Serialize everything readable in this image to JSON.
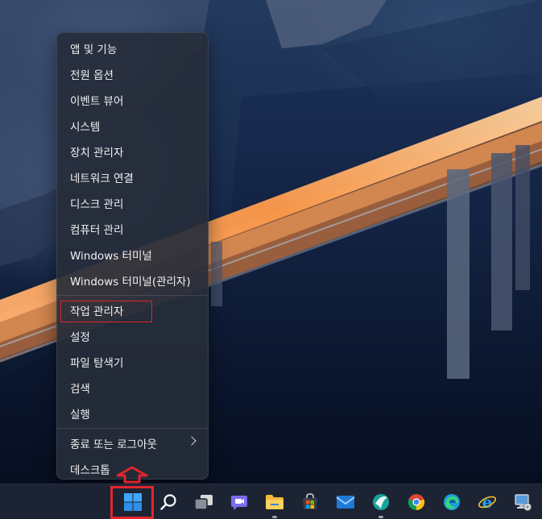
{
  "context_menu": {
    "items": [
      {
        "label": "앱 및 기능"
      },
      {
        "label": "전원 옵션"
      },
      {
        "label": "이벤트 뷰어"
      },
      {
        "label": "시스템"
      },
      {
        "label": "장치 관리자"
      },
      {
        "label": "네트워크 연결"
      },
      {
        "label": "디스크 관리"
      },
      {
        "label": "컴퓨터 관리"
      },
      {
        "label": "Windows 터미널"
      },
      {
        "label": "Windows 터미널(관리자)"
      },
      {
        "label": "작업 관리자"
      },
      {
        "label": "설정"
      },
      {
        "label": "파일 탐색기"
      },
      {
        "label": "검색"
      },
      {
        "label": "실행"
      },
      {
        "label": "종료 또는 로그아웃"
      },
      {
        "label": "데스크톱"
      }
    ],
    "highlighted_item": "작업 관리자",
    "submenu_item": "종료 또는 로그아웃"
  },
  "taskbar": {
    "icons": [
      "start-icon",
      "search-icon",
      "task-view-icon",
      "chat-icon",
      "file-explorer-icon",
      "store-icon",
      "mail-icon",
      "app-icon",
      "chrome-icon",
      "edge-icon",
      "ie-icon",
      "network-computer-icon"
    ]
  },
  "colors": {
    "highlight": "#e0262c",
    "menu_bg": "#262c3a",
    "taskbar_bg": "#1c2433"
  }
}
